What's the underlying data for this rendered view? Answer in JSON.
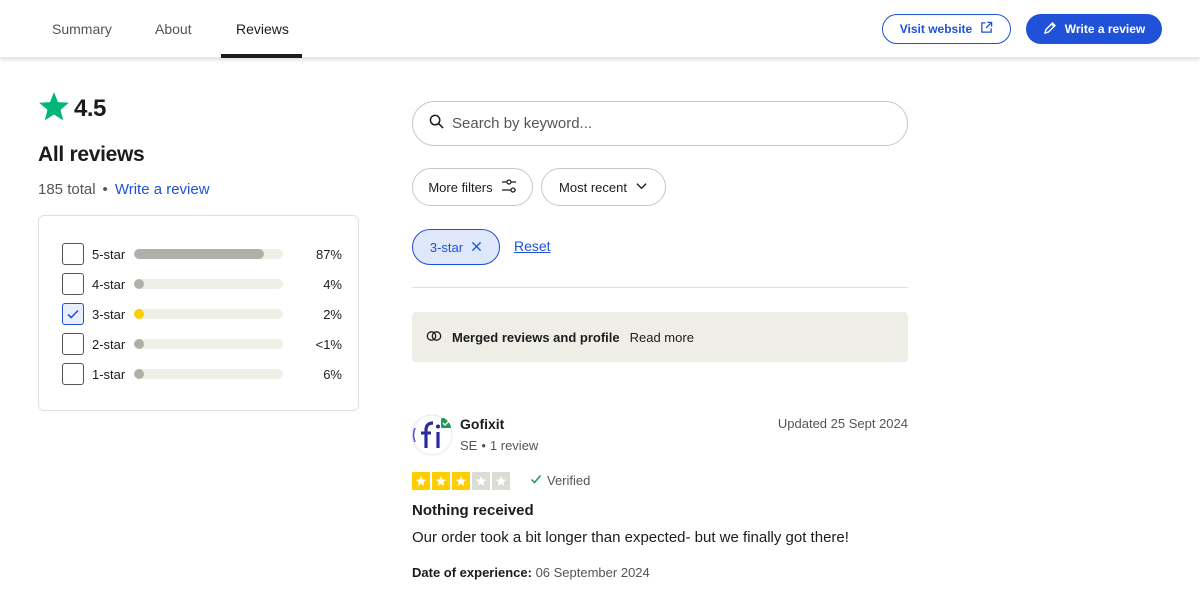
{
  "nav": {
    "tabs": [
      {
        "label": "Summary"
      },
      {
        "label": "About"
      },
      {
        "label": "Reviews"
      }
    ],
    "visit_website": "Visit website",
    "write_review": "Write a review"
  },
  "summary": {
    "rating": "4.5",
    "heading": "All reviews",
    "total": "185 total",
    "separator": "•",
    "write_link": "Write a review",
    "distribution": [
      {
        "label": "5-star",
        "pct_text": "87%",
        "value": 87,
        "checked": false
      },
      {
        "label": "4-star",
        "pct_text": "4%",
        "value": 4,
        "checked": false
      },
      {
        "label": "3-star",
        "pct_text": "2%",
        "value": 2,
        "checked": true
      },
      {
        "label": "2-star",
        "pct_text": "<1%",
        "value": 0.5,
        "checked": false
      },
      {
        "label": "1-star",
        "pct_text": "6%",
        "value": 6,
        "checked": false
      }
    ]
  },
  "search": {
    "placeholder": "Search by keyword..."
  },
  "filters": {
    "more_filters": "More filters",
    "sort": "Most recent",
    "active_chip": "3-star",
    "reset": "Reset"
  },
  "notice": {
    "title": "Merged reviews and profile",
    "link": "Read more"
  },
  "review": {
    "name": "Gofixit",
    "country": "SE",
    "dot": "•",
    "count": "1 review",
    "date": "Updated 25 Sept 2024",
    "stars": 3,
    "verified": "Verified",
    "title": "Nothing received",
    "body": "Our order took a bit longer than expected- but we finally got there!",
    "exp_label": "Date of experience:",
    "exp_date": "06 September 2024"
  },
  "colors": {
    "accent": "#1f52d9",
    "trust_green": "#00b67a",
    "star_yellow": "#ffce00"
  }
}
